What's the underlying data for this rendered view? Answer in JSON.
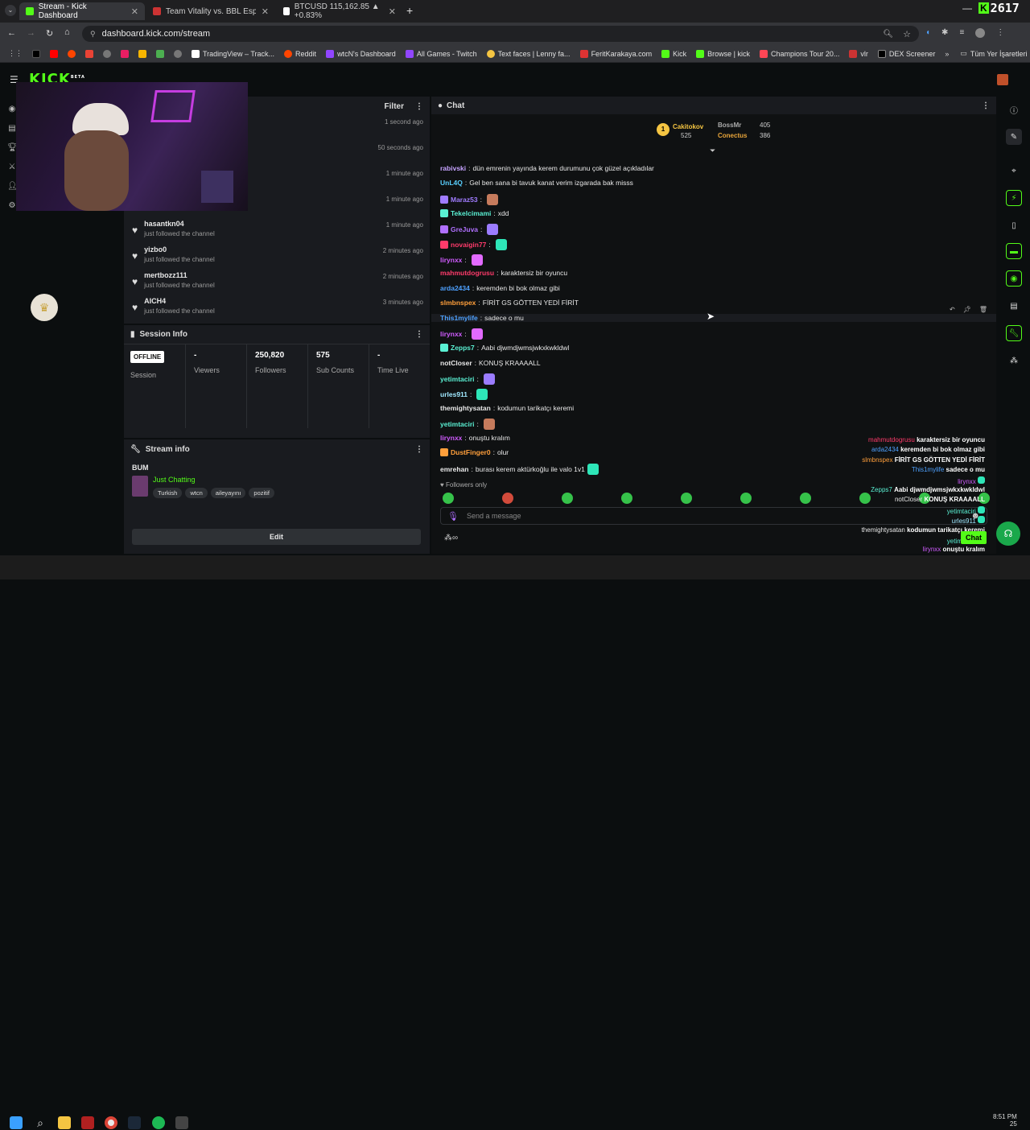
{
  "browser": {
    "tabs": [
      {
        "title": "Stream - Kick Dashboard",
        "active": true
      },
      {
        "title": "Team Vitality vs. BBL Esports | V",
        "active": false
      },
      {
        "title": "BTCUSD 115,162.85 ▲ +0.83%",
        "active": false
      }
    ],
    "url": "dashboard.kick.com/stream",
    "overlay_counter": "2617",
    "bookmarks": [
      "TradingView – Track...",
      "Reddit",
      "wtcN's Dashboard",
      "All Games - Twitch",
      "Text faces | Lenny fa...",
      "FeritKarakaya.com",
      "Kick",
      "Browse | kick",
      "Champions Tour 20...",
      "vlr",
      "DEX Screener"
    ],
    "all_bookmarks": "Tüm Yer İşaretleri"
  },
  "kick": {
    "logo": "KICK",
    "logo_badge": "BETA"
  },
  "activity": {
    "filter_label": "Filter",
    "items": [
      {
        "name": "",
        "sub": "",
        "time": "1 second ago"
      },
      {
        "name": "",
        "sub": "",
        "time": "50 seconds ago"
      },
      {
        "name": "",
        "sub": "",
        "time": "1 minute ago"
      },
      {
        "name": "",
        "sub": "just followed the channel",
        "time": "1 minute ago"
      },
      {
        "name": "hasantkn04",
        "sub": "just followed the channel",
        "time": "1 minute ago"
      },
      {
        "name": "yizbo0",
        "sub": "just followed the channel",
        "time": "2 minutes ago"
      },
      {
        "name": "mertbozz111",
        "sub": "just followed the channel",
        "time": "2 minutes ago"
      },
      {
        "name": "AICH4",
        "sub": "just followed the channel",
        "time": "3 minutes ago"
      }
    ]
  },
  "session": {
    "title": "Session Info",
    "status": "OFFLINE",
    "cells": [
      {
        "value": "",
        "label": "Session"
      },
      {
        "value": "-",
        "label": "Viewers"
      },
      {
        "value": "250,820",
        "label": "Followers"
      },
      {
        "value": "575",
        "label": "Sub Counts"
      },
      {
        "value": "-",
        "label": "Time Live"
      }
    ]
  },
  "stream_info": {
    "title": "Stream info",
    "stream_title": "BUM",
    "category": "Just Chatting",
    "tags": [
      "Turkish",
      "wtcn",
      "aileyayını",
      "pozitif"
    ],
    "edit_label": "Edit"
  },
  "chat": {
    "title": "Chat",
    "leaderboard": [
      {
        "name": "Cakitokov",
        "value": "525",
        "color": "#f5c542"
      },
      {
        "name": "BossMr",
        "value": "405",
        "color": "#aaaaaa"
      },
      {
        "name": "Conectus",
        "value": "386",
        "color": "#e8a53a"
      }
    ],
    "messages": [
      {
        "user": "rabivski",
        "text": "dün emrenin yayında kerem durumunu çok güzel açıkladılar",
        "color": "#c6a3ff"
      },
      {
        "user": "UnL4Q",
        "text": "Gel ben sana bi tavuk kanat verim izgarada bak misss",
        "color": "#59d0ff"
      },
      {
        "user": "Maraz53",
        "text": "",
        "color": "#a07cff"
      },
      {
        "user": "Tekelcimami",
        "text": "xdd",
        "color": "#5af0d3"
      },
      {
        "user": "GreJuva",
        "text": "",
        "color": "#b070ff"
      },
      {
        "user": "novaigin77",
        "text": "",
        "color": "#ff3b6b"
      },
      {
        "user": "lirynxx",
        "text": "",
        "color": "#d05cff"
      },
      {
        "user": "mahmutdogrusu",
        "text": "karaktersiz bir oyuncu",
        "color": "#ff3b6b"
      },
      {
        "user": "arda2434",
        "text": "keremden bi bok olmaz gibi",
        "color": "#4ea1ff"
      },
      {
        "user": "slmbnspex",
        "text": "FİRİT GS GÖTTEN YEDİ FİRİT",
        "color": "#ff9f3b"
      },
      {
        "user": "This1mylife",
        "text": "sadece o mu",
        "color": "#4ea1ff"
      },
      {
        "user": "lirynxx",
        "text": "",
        "color": "#d05cff"
      },
      {
        "user": "Zepps7",
        "text": "Aabi djwmdjwmsjwkxkwkldwl",
        "color": "#5af0d3"
      },
      {
        "user": "notCloser",
        "text": "KONUŞ KRAAAALL",
        "color": "#e8e8e8"
      },
      {
        "user": "yetimtaciri",
        "text": "",
        "color": "#5af0d3"
      },
      {
        "user": "urles911",
        "text": "",
        "color": "#a0e8ff"
      },
      {
        "user": "themightysatan",
        "text": "kodumun tarikatçı keremi",
        "color": "#e8e8e8"
      },
      {
        "user": "yetimtaciri",
        "text": "",
        "color": "#5af0d3"
      },
      {
        "user": "lirynxx",
        "text": "onuştu kralım",
        "color": "#d05cff"
      },
      {
        "user": "DustFinger0",
        "text": "olur",
        "color": "#ff9f3b"
      },
      {
        "user": "emrehan",
        "text": "burası kerem aktürkoğlu ile valo 1v1",
        "color": "#e8e8e8"
      }
    ],
    "followers_only": "Followers only",
    "input_placeholder": "Send a message",
    "chat_button": "Chat"
  },
  "overlay_chat": [
    {
      "user": "mahmutdogrusu",
      "text": "karaktersiz bir oyuncu",
      "color": "#ff3b6b"
    },
    {
      "user": "arda2434",
      "text": "keremden bi bok olmaz gibi",
      "color": "#4ea1ff"
    },
    {
      "user": "slmbnspex",
      "text": "FİRİT GS GÖTTEN YEDİ FİRİT",
      "color": "#ff9f3b"
    },
    {
      "user": "This1mylife",
      "text": "sadece o mu",
      "color": "#4ea1ff"
    },
    {
      "user": "lirynxx",
      "text": "",
      "color": "#d05cff"
    },
    {
      "user": "Zepps7",
      "text": "Aabi djwmdjwmsjwkxkwkldwl",
      "color": "#5af0d3"
    },
    {
      "user": "notCloser",
      "text": "KONUŞ KRAAAALL",
      "color": "#e8e8e8"
    },
    {
      "user": "yetimtaciri",
      "text": "",
      "color": "#5af0d3"
    },
    {
      "user": "urles911",
      "text": "",
      "color": "#a0e8ff"
    },
    {
      "user": "themightysatan",
      "text": "kodumun tarikatçı keremi",
      "color": "#e8e8e8"
    },
    {
      "user": "yetimtaciri",
      "text": "",
      "color": "#5af0d3"
    },
    {
      "user": "lirynxx",
      "text": "onuştu kralım",
      "color": "#d05cff"
    },
    {
      "user": "DustFinger0",
      "text": "olur",
      "color": "#ff9f3b"
    },
    {
      "user": "emrehan",
      "text": "burası kerem aktürkoğlu ile valo 1v1",
      "color": "#e8e8e8"
    }
  ],
  "taskbar": {
    "time": "8:51 PM",
    "date_suffix": "25"
  },
  "accent": "#53fc18"
}
